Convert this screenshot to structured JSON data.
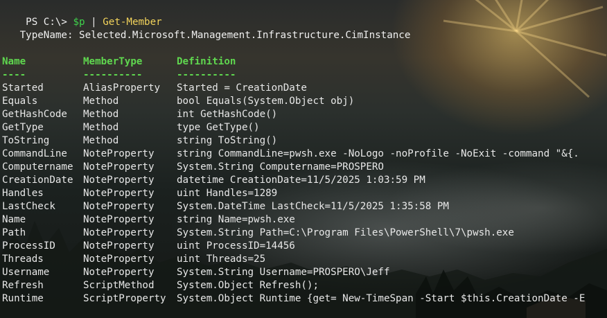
{
  "prompt": {
    "ps": "PS C:\\>",
    "variable": "$p",
    "pipe": "|",
    "command": "Get-Member"
  },
  "typename": "   TypeName: Selected.Microsoft.Management.Infrastructure.CimInstance",
  "headers": {
    "name": "Name",
    "membertype": "MemberType",
    "definition": "Definition",
    "name_rule": "----",
    "membertype_rule": "----------",
    "definition_rule": "----------"
  },
  "rows": [
    {
      "name": "Started",
      "type": "AliasProperty",
      "def": "Started = CreationDate"
    },
    {
      "name": "Equals",
      "type": "Method",
      "def": "bool Equals(System.Object obj)"
    },
    {
      "name": "GetHashCode",
      "type": "Method",
      "def": "int GetHashCode()"
    },
    {
      "name": "GetType",
      "type": "Method",
      "def": "type GetType()"
    },
    {
      "name": "ToString",
      "type": "Method",
      "def": "string ToString()"
    },
    {
      "name": "CommandLine",
      "type": "NoteProperty",
      "def": "string CommandLine=pwsh.exe -NoLogo -noProfile -NoExit -command \"&{."
    },
    {
      "name": "Computername",
      "type": "NoteProperty",
      "def": "System.String Computername=PROSPERO"
    },
    {
      "name": "CreationDate",
      "type": "NoteProperty",
      "def": "datetime CreationDate=11/5/2025 1:03:59 PM"
    },
    {
      "name": "Handles",
      "type": "NoteProperty",
      "def": "uint Handles=1289"
    },
    {
      "name": "LastCheck",
      "type": "NoteProperty",
      "def": "System.DateTime LastCheck=11/5/2025 1:35:58 PM"
    },
    {
      "name": "Name",
      "type": "NoteProperty",
      "def": "string Name=pwsh.exe"
    },
    {
      "name": "Path",
      "type": "NoteProperty",
      "def": "System.String Path=C:\\Program Files\\PowerShell\\7\\pwsh.exe"
    },
    {
      "name": "ProcessID",
      "type": "NoteProperty",
      "def": "uint ProcessID=14456"
    },
    {
      "name": "Threads",
      "type": "NoteProperty",
      "def": "uint Threads=25"
    },
    {
      "name": "Username",
      "type": "NoteProperty",
      "def": "System.String Username=PROSPERO\\Jeff"
    },
    {
      "name": "Refresh",
      "type": "ScriptMethod",
      "def": "System.Object Refresh();"
    },
    {
      "name": "Runtime",
      "type": "ScriptProperty",
      "def": "System.Object Runtime {get= New-TimeSpan -Start $this.CreationDate -E"
    }
  ],
  "colors": {
    "header": "#5fd74f",
    "variable": "#3fd24b",
    "command": "#f2d35b",
    "text": "#e8e8e8"
  }
}
